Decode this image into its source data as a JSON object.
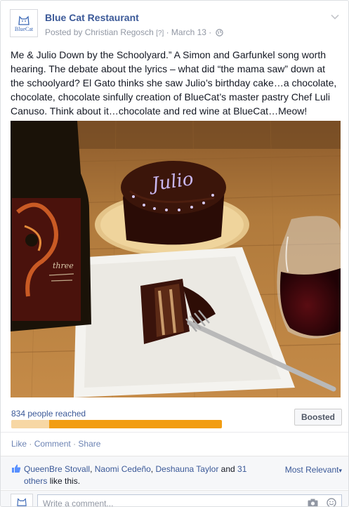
{
  "post": {
    "page_name": "Blue Cat Restaurant",
    "avatar_brand": "BlueCat",
    "byline_prefix": "Posted by",
    "author": "Christian Regosch",
    "help_marker": "[?]",
    "dot_separator": "·",
    "date": "March 13",
    "body": "Me & Julio Down by the Schoolyard.” A Simon and Garfunkel song worth hearing. The debate about the lyrics – what did “the mama saw” down at the schoolyard? El Gato thinks she saw Julio’s birthday cake…a chocolate, chocolate, chocolate sinfully creation of BlueCat’s master pastry Chef Luli Canuso. Think about it…chocolate and red wine at BlueCat…Meow!"
  },
  "photo": {
    "cake_writing": "Julio"
  },
  "reach": {
    "text": "834 people reached",
    "organic_fraction": 0.18,
    "paid_fraction": 0.82,
    "boost_label": "Boosted"
  },
  "actions": {
    "like": "Like",
    "comment": "Comment",
    "share": "Share",
    "separator": "·"
  },
  "likes": {
    "names": [
      "QueenBre Stovall",
      "Naomi Cedeño",
      "Deshauna Taylor"
    ],
    "separator_comma": ",",
    "and_word": "and",
    "others_count": "31",
    "others_word": "others",
    "suffix": "like this.",
    "sort_label": "Most Relevant",
    "sort_caret": "▾"
  },
  "comment_box": {
    "placeholder": "Write a comment..."
  },
  "icons": {
    "chevron": "chevron-down-icon",
    "globe": "globe-icon",
    "thumb": "thumbs-up-icon",
    "camera": "camera-icon",
    "emoji": "emoji-icon"
  },
  "colors": {
    "link": "#3b5998",
    "meta": "#9197a3",
    "reach_bar": "#f29d12",
    "reach_bar_light": "#f7d7a4"
  }
}
